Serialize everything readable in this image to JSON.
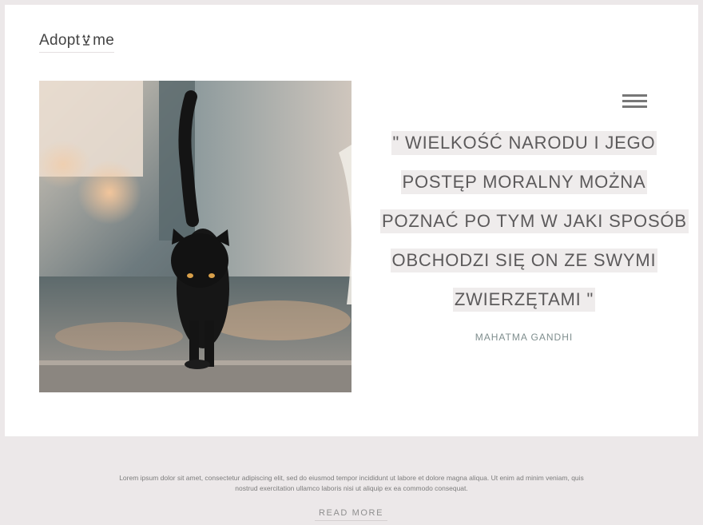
{
  "header": {
    "logo_prefix": "Adopt",
    "logo_suffix": "me",
    "logo_mark_icon": "cat-ears-icon"
  },
  "hero": {
    "image_icon": "black-cat-photo",
    "menu_icon": "hamburger-menu-icon"
  },
  "quote": {
    "lines": [
      "\" WIELKOŚĆ NARODU I JEGO",
      "POSTĘP MORALNY MOŻNA",
      "POZNAĆ PO TYM W JAKI SPOSÓB",
      "OBCHODZI SIĘ ON ZE SWYMI",
      "ZWIERZĘTAMI \""
    ],
    "author": "MAHATMA GANDHI"
  },
  "footer": {
    "text": "Lorem ipsum dolor sit amet, consectetur adipiscing elit, sed do eiusmod tempor incididunt ut labore et dolore magna aliqua. Ut enim ad minim veniam, quis nostrud exercitation ullamco laboris nisi ut aliquip ex ea commodo consequat.",
    "read_more_label": "READ MORE"
  },
  "colors": {
    "page_background": "#ece8e9",
    "card_background": "#ffffff",
    "quote_highlight": "#efecec",
    "author_color": "#7f8e8e"
  }
}
